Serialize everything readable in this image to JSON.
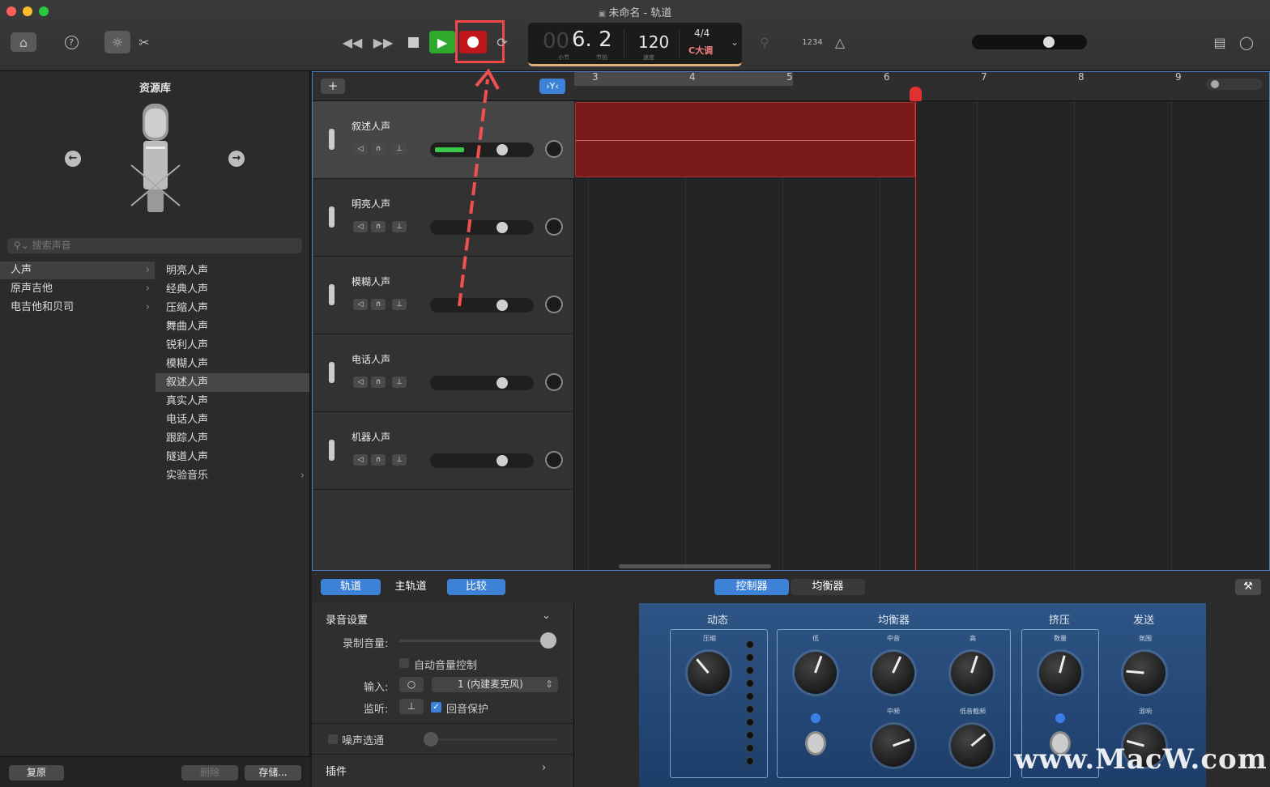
{
  "window": {
    "title": "未命名 - 轨道"
  },
  "transport": {
    "bar_prefix": "00",
    "position": "6. 2",
    "bar_label": "小节",
    "beat_label": "节拍",
    "tempo": "120",
    "tempo_label": "速度",
    "time_sig": "4/4",
    "key": "C大调",
    "count_in": "1234"
  },
  "library": {
    "title": "资源库",
    "search_placeholder": "搜索声音",
    "categories": [
      {
        "label": "人声"
      },
      {
        "label": "原声吉他"
      },
      {
        "label": "电吉他和贝司"
      }
    ],
    "patches": [
      "明亮人声",
      "经典人声",
      "压缩人声",
      "舞曲人声",
      "锐利人声",
      "模糊人声",
      "叙述人声",
      "真实人声",
      "电话人声",
      "跟踪人声",
      "隧道人声",
      "实验音乐"
    ],
    "footer": {
      "revert": "复原",
      "delete": "删除",
      "save": "存储..."
    }
  },
  "tracks": [
    {
      "name": "叙述人声"
    },
    {
      "name": "明亮人声"
    },
    {
      "name": "模糊人声"
    },
    {
      "name": "电话人声"
    },
    {
      "name": "机器人声"
    }
  ],
  "ruler": {
    "bars": [
      "3",
      "4",
      "5",
      "6",
      "7",
      "8",
      "9"
    ]
  },
  "editor": {
    "tabs_left": [
      "轨道",
      "主轨道",
      "比较"
    ],
    "tabs_center": [
      "控制器",
      "均衡器"
    ],
    "settings": {
      "section": "录音设置",
      "record_level": "录制音量:",
      "auto_level": "自动音量控制",
      "input": "输入:",
      "input_value": "1 (内建麦克风)",
      "monitor": "监听:",
      "feedback": "回音保护",
      "noise_gate": "噪声选通",
      "plugins": "插件"
    },
    "plugin": {
      "dynamics": "动态",
      "compress": "压缩",
      "eq": "均衡器",
      "low": "低",
      "mid": "中音",
      "high": "高",
      "mid_freq": "中频",
      "low_cut": "低音截频",
      "squeeze": "挤压",
      "amount": "数量",
      "send": "发送",
      "ambience": "氛围",
      "reverb": "混响"
    }
  },
  "watermark": "www.MacW.com",
  "colors": {
    "record": "#c0161c",
    "play": "#2fa92d",
    "accent": "#3d82d6",
    "region": "#7a1a1a",
    "playhead": "#e03030",
    "annotation": "#f05050"
  }
}
